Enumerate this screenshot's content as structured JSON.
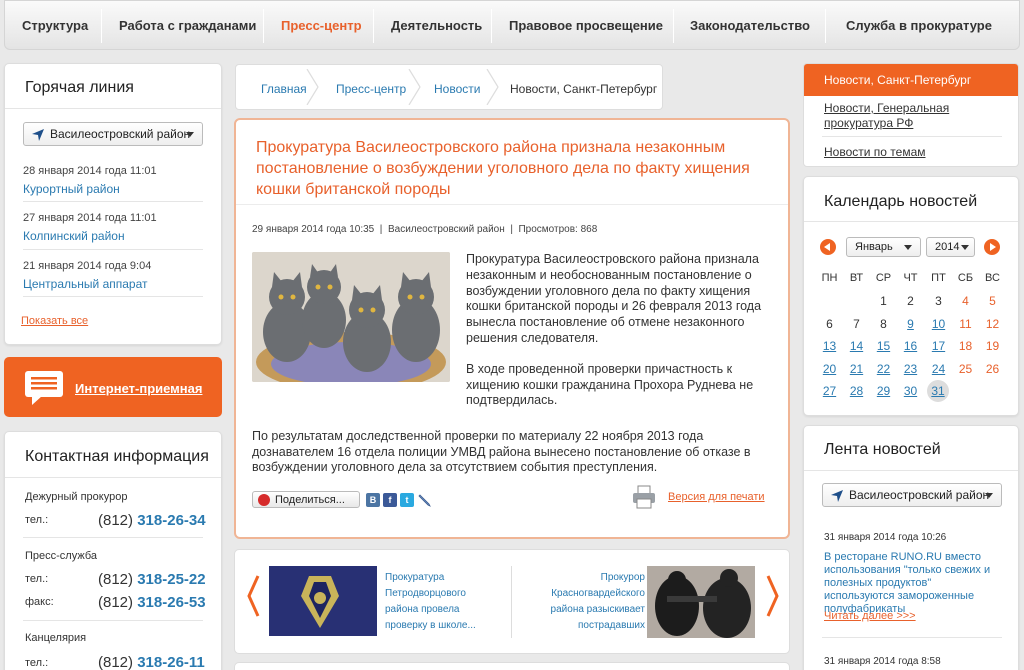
{
  "nav": {
    "items": [
      "Структура",
      "Работа с гражданами",
      "Пресс-центр",
      "Деятельность",
      "Правовое просвещение",
      "Законодательство",
      "Служба в прокуратуре"
    ],
    "active_index": 2
  },
  "hotline": {
    "title": "Горячая линия",
    "district_select": "Василеостровский район",
    "items": [
      {
        "date": "28 января 2014 года 11:01",
        "link": "Курортный район"
      },
      {
        "date": "27 января 2014 года 11:01",
        "link": "Колпинский район"
      },
      {
        "date": "21 января 2014 года 9:04",
        "link": "Центральный аппарат"
      }
    ],
    "show_all": "Показать все"
  },
  "reception": {
    "label": "Интернет-приемная"
  },
  "contacts": {
    "title": "Контактная информация",
    "groups": [
      {
        "name": "Дежурный прокурор",
        "lines": [
          {
            "label": "тел.:",
            "code": "(812)",
            "number": "318-26-34"
          }
        ]
      },
      {
        "name": "Пресс-служба",
        "lines": [
          {
            "label": "тел.:",
            "code": "(812)",
            "number": "318-25-22"
          },
          {
            "label": "факс:",
            "code": "(812)",
            "number": "318-26-53"
          }
        ]
      },
      {
        "name": "Канцелярия",
        "lines": [
          {
            "label": "тел.:",
            "code": "(812)",
            "number": "318-26-11"
          }
        ]
      }
    ]
  },
  "breadcrumb": {
    "items": [
      "Главная",
      "Пресс-центр",
      "Новости"
    ],
    "current": "Новости, Санкт-Петербург"
  },
  "article": {
    "title": "Прокуратура Василеостровского района признала незаконным постановление о возбуждении уголовного дела по факту хищения кошки британской породы",
    "date": "29 января 2014 года 10:35",
    "district": "Василеостровский район",
    "views": "Просмотров: 868",
    "para1": "Прокуратура Василеостровского района признала незаконным и необоснованным постановление о возбуждении уголовного дела по факту хищения кошки британской породы и 26 февраля 2013 года вынесла постановление об отмене незаконного решения следователя.",
    "para2": "В ходе проведенной проверки причастность к хищению кошки гражданина Прохора Руднева не подтвердилась.",
    "para3": "По результатам доследственной проверки по материалу 22 ноября 2013 года дознавателем 16 отдела полиции УМВД района вынесено постановление об отказе в возбуждении уголовного дела за отсутствием события преступления.",
    "share": "Поделиться...",
    "print": "Версия для печати"
  },
  "carousel": {
    "left_text": "Прокуратура Петродворцового района провела проверку в школе...",
    "right_text": "Прокурор Красногвардейского района разыскивает пострадавших"
  },
  "right_nav": {
    "active": "Новости, Санкт-Петербург",
    "items": [
      "Новости, Генеральная прокуратура РФ",
      "Новости по темам"
    ]
  },
  "calendar": {
    "title": "Календарь новостей",
    "month": "Январь",
    "year": "2014",
    "weekdays": [
      "ПН",
      "ВТ",
      "СР",
      "ЧТ",
      "ПТ",
      "СБ",
      "ВС"
    ],
    "weeks": [
      [
        "",
        "",
        "1",
        "2",
        "3",
        "4",
        "5"
      ],
      [
        "6",
        "7",
        "8",
        "9",
        "10",
        "11",
        "12"
      ],
      [
        "13",
        "14",
        "15",
        "16",
        "17",
        "18",
        "19"
      ],
      [
        "20",
        "21",
        "22",
        "23",
        "24",
        "25",
        "26"
      ],
      [
        "27",
        "28",
        "29",
        "30",
        "31",
        "",
        ""
      ]
    ],
    "link_days": [
      "9",
      "10",
      "13",
      "14",
      "15",
      "16",
      "17",
      "20",
      "21",
      "22",
      "23",
      "24",
      "27",
      "28",
      "29",
      "30",
      "31"
    ],
    "today": "31"
  },
  "feed": {
    "title": "Лента новостей",
    "district_select": "Василеостровский район",
    "items": [
      {
        "date": "31 января 2014 года 10:26",
        "text": "В ресторане RUNO.RU вместо использования \"только свежих и полезных продуктов\" используются замороженные полуфабрикаты",
        "more": "Читать далее >>>"
      },
      {
        "date": "31 января 2014 года 8:58"
      }
    ]
  },
  "colors": {
    "accent": "#ef6322",
    "link": "#2a7ab0"
  }
}
